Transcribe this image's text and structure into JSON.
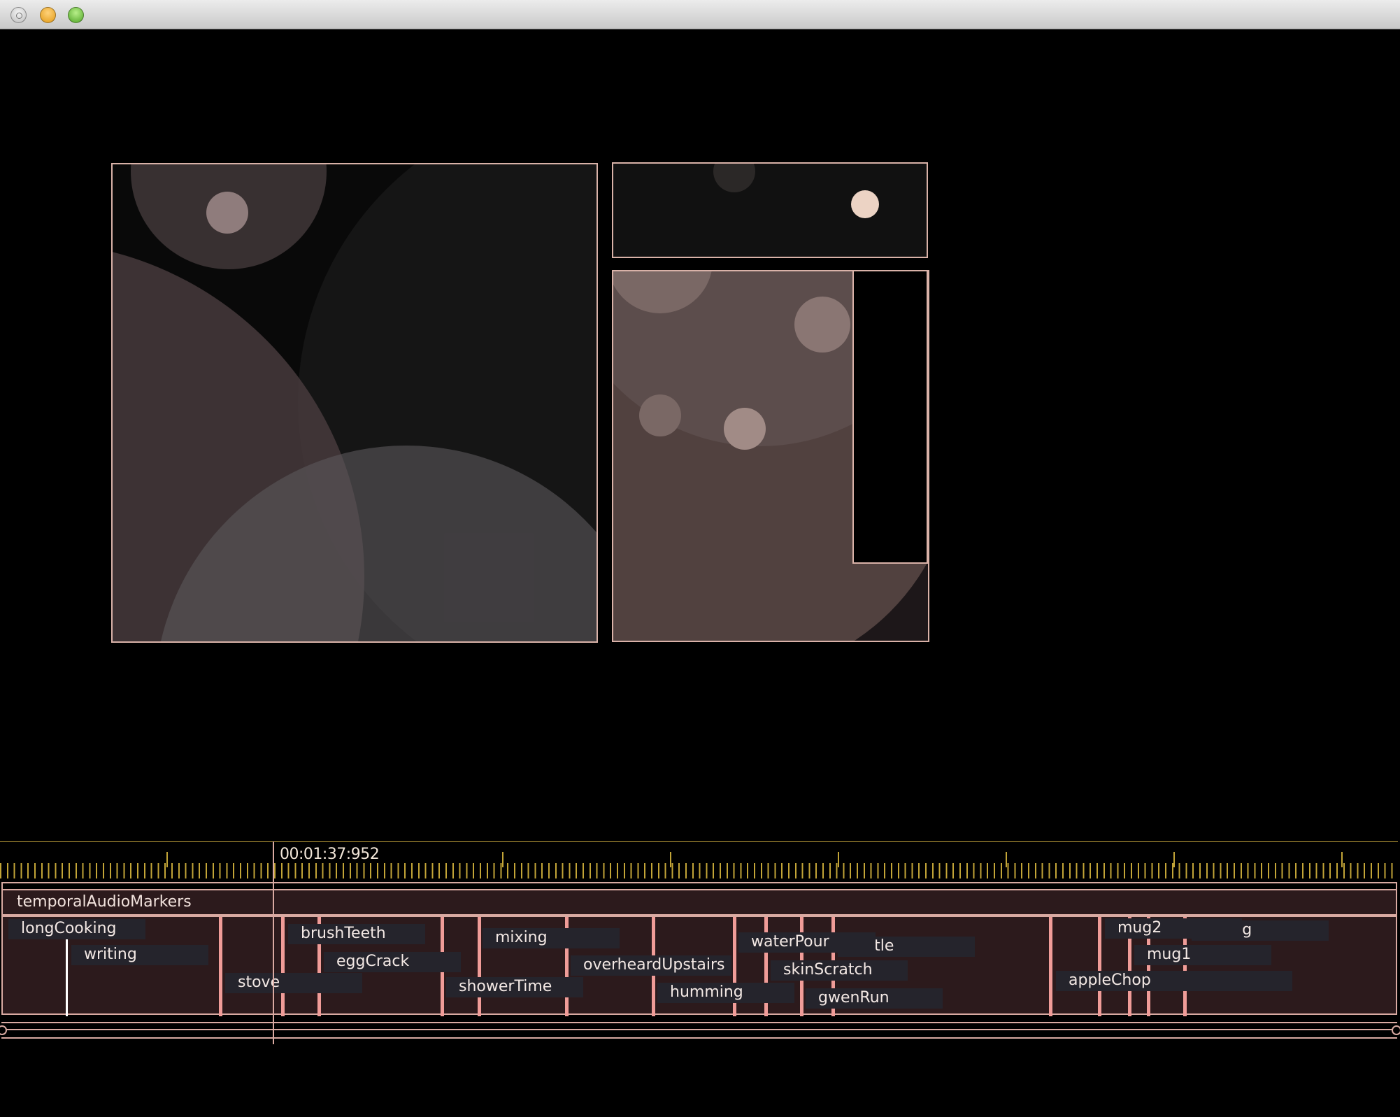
{
  "window": {
    "controls": [
      "close-button",
      "minimize-button",
      "zoom-button"
    ]
  },
  "timeline": {
    "playhead_time": "00:01:37:952",
    "track_name": "temporalAudioMarkers",
    "markers": [
      {
        "label": "longCooking"
      },
      {
        "label": "writing"
      },
      {
        "label": "stove"
      },
      {
        "label": "brushTeeth"
      },
      {
        "label": "eggCrack"
      },
      {
        "label": "showerTime"
      },
      {
        "label": "mixing"
      },
      {
        "label": "overheardUpstairs"
      },
      {
        "label": "humming"
      },
      {
        "label": "waterPour"
      },
      {
        "label": "skinScratch"
      },
      {
        "label": "gwenRun"
      },
      {
        "label": "kettle"
      },
      {
        "label": "appleChop"
      },
      {
        "label": "mug2"
      },
      {
        "label": "mug1"
      },
      {
        "label": "crying"
      }
    ]
  },
  "colors": {
    "pane_border": "#d9b2a8",
    "ruler_ticks": "#c2a437",
    "marker_flag": "#f09c98",
    "track_background": "#2c1a1c",
    "marker_label_background": "#25242c"
  }
}
